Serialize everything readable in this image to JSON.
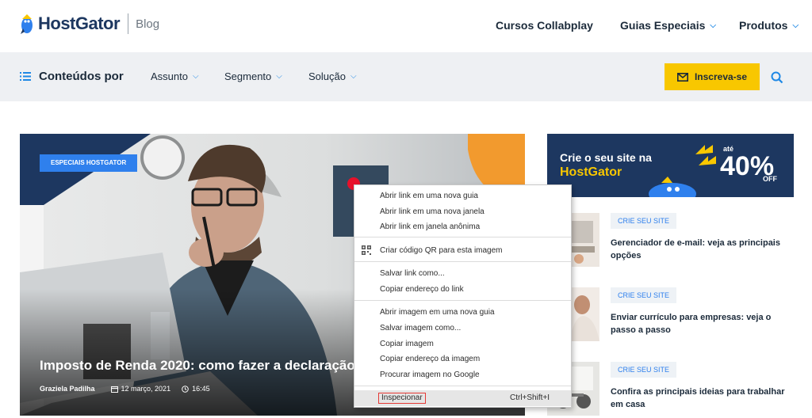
{
  "header": {
    "logo_text": "HostGator",
    "logo_suffix": "Blog",
    "nav": [
      {
        "label": "Cursos Collabplay",
        "has_dropdown": false
      },
      {
        "label": "Guias Especiais",
        "has_dropdown": true
      },
      {
        "label": "Produtos",
        "has_dropdown": true
      }
    ]
  },
  "subnav": {
    "title": "Conteúdos por",
    "items": [
      {
        "label": "Assunto"
      },
      {
        "label": "Segmento"
      },
      {
        "label": "Solução"
      }
    ],
    "subscribe_label": "Inscreva-se"
  },
  "hero": {
    "tag": "ESPECIAIS HOSTGATOR",
    "title": "Imposto de Renda 2020: como fazer a declaração",
    "author": "Graziela Padilha",
    "date": "12 março, 2021",
    "time": "16:45"
  },
  "banner": {
    "line1": "Crie o seu site na",
    "line2": "HostGator",
    "ate": "até",
    "percent": "40%",
    "off": "OFF"
  },
  "sidebar_posts": [
    {
      "tag": "CRIE SEU SITE",
      "title": "Gerenciador de e-mail: veja as principais opções"
    },
    {
      "tag": "CRIE SEU SITE",
      "title": "Enviar currículo para empresas: veja o passo a passo"
    },
    {
      "tag": "CRIE SEU SITE",
      "title": "Confira as principais ideias para trabalhar em casa"
    }
  ],
  "context_menu": {
    "items": [
      "Abrir link em uma nova guia",
      "Abrir link em uma nova janela",
      "Abrir link em janela anônima",
      "Criar código QR para esta imagem",
      "Salvar link como...",
      "Copiar endereço do link",
      "Abrir imagem em uma nova guia",
      "Salvar imagem como...",
      "Copiar imagem",
      "Copiar endereço da imagem",
      "Procurar imagem no Google"
    ],
    "inspect_label": "Inspecionar",
    "inspect_shortcut": "Ctrl+Shift+I"
  },
  "colors": {
    "brand_navy": "#1d3760",
    "accent_blue": "#2f80ed",
    "cta_yellow": "#f8c700",
    "cursor_marker": "#e8102a"
  }
}
